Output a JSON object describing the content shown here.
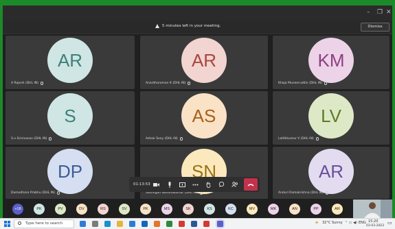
{
  "banner": {
    "message": "5 minutes left in your meeting.",
    "dismiss_label": "Dismiss"
  },
  "window_controls": {
    "minimize": "–",
    "restore": "❐",
    "close": "✕"
  },
  "participants": [
    {
      "initials": "AR",
      "name": "A Rajesh (DHL IN)",
      "color": "#cfe6e4",
      "text_color": "#3f7f79"
    },
    {
      "initials": "AR",
      "name": "Anantharaman K (DHL IN)",
      "color": "#f2d4d1",
      "text_color": "#a6483d"
    },
    {
      "initials": "KM",
      "name": "Khaja Muneeruddin (DHL IN)",
      "color": "#ecd3e7",
      "text_color": "#8f3e83"
    },
    {
      "initials": "S",
      "name": "S.n.Srinivasan (DHL IN)",
      "color": "#cfe6e4",
      "text_color": "#3f7f79"
    },
    {
      "initials": "AS",
      "name": "Ashok Sony (DHL IN)",
      "color": "#f9e2c6",
      "text_color": "#a8601a"
    },
    {
      "initials": "LV",
      "name": "Lalithkumar V (DHL IN)",
      "color": "#dde9c6",
      "text_color": "#5f7a26"
    },
    {
      "initials": "DP",
      "name": "Damodhara Prabhu (DHL IN)",
      "color": "#d5dff1",
      "text_color": "#3d5d97"
    },
    {
      "initials": "SN",
      "name": "Sasmigan Nandhakumar (DHL IN)",
      "color": "#fbe9bd",
      "text_color": "#9b7213"
    },
    {
      "initials": "AR",
      "name": "Anduri Ramakrishna (DHL IN)",
      "color": "#e3dcf0",
      "text_color": "#6a4f9c"
    }
  ],
  "controls": {
    "timer": "01:13:53",
    "camera": "camera",
    "mic": "mic",
    "share": "share",
    "more": "more",
    "hand": "hand",
    "react": "react",
    "people": "people",
    "leave": "leave"
  },
  "strip": [
    {
      "label": "+18",
      "color": "#5b5fc7",
      "text_color": "#ffffff"
    },
    {
      "label": "PK",
      "color": "#cfe6e4"
    },
    {
      "label": "PV",
      "color": "#dde9c6"
    },
    {
      "label": "DV",
      "color": "#f9e2c6"
    },
    {
      "label": "RS",
      "color": "#f2d4d1"
    },
    {
      "label": "SV",
      "color": "#dde9c6"
    },
    {
      "label": "PK",
      "color": "#f9e2c6"
    },
    {
      "label": "MS",
      "color": "#ecd3e7"
    },
    {
      "label": "SK",
      "color": "#f2d4d1"
    },
    {
      "label": "KS",
      "color": "#cfe6e4"
    },
    {
      "label": "KC",
      "color": "#d5dff1"
    },
    {
      "label": "MV",
      "color": "#fbe9bd"
    },
    {
      "label": "MK",
      "color": "#ecd3e7"
    },
    {
      "label": "AN",
      "color": "#f9e2c6"
    },
    {
      "label": "PP",
      "color": "#ecd3e7"
    },
    {
      "label": "AR",
      "color": "#fbe9bd"
    }
  ],
  "taskbar": {
    "search_placeholder": "Type here to search",
    "weather": "32°C  Sunny",
    "lang": "ENG",
    "time": "15:20",
    "date": "03-03-2023"
  }
}
